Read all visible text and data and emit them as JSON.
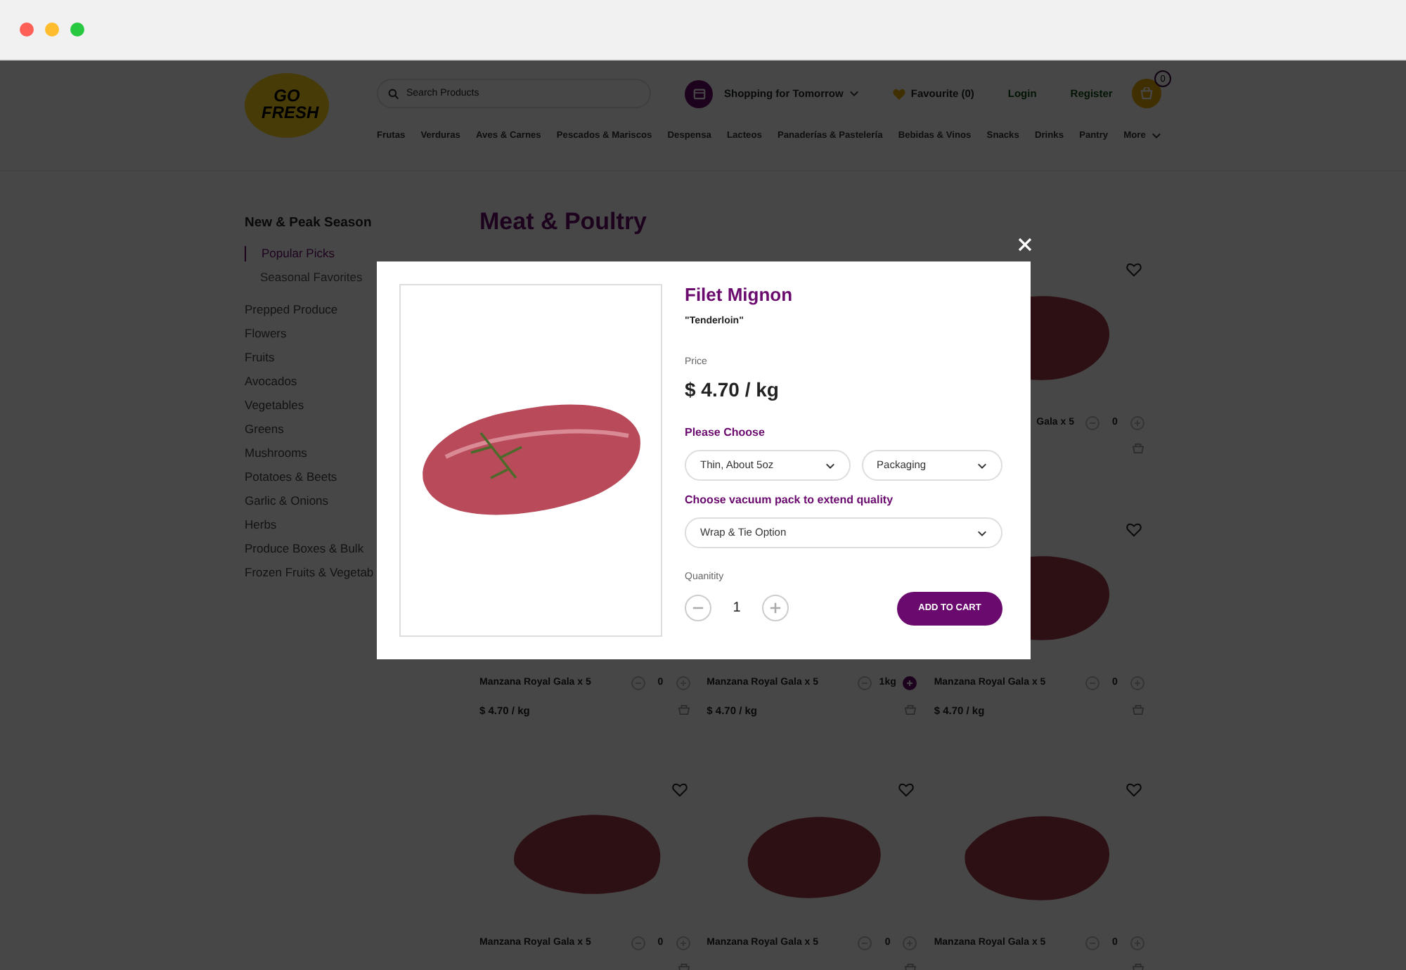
{
  "window": {
    "controls": [
      {
        "color": "#fe5f57"
      },
      {
        "color": "#febc2e"
      },
      {
        "color": "#28c840"
      }
    ]
  },
  "header": {
    "logo": "GO FRESH",
    "search": {
      "placeholder": "Search Products"
    },
    "delivery": "Shopping for Tomorrow",
    "favourite": "Favourite (0)",
    "login": "Login",
    "register": "Register",
    "cart_count": "0",
    "nav": [
      "Frutas",
      "Verduras",
      "Aves & Carnes",
      "Pescados & Mariscos",
      "Despensa",
      "Lacteos",
      "Panaderías & Pastelería",
      "Bebidas & Vinos",
      "Snacks",
      "Drinks",
      "Pantry"
    ],
    "more": "More"
  },
  "sidebar": {
    "heading": "New & Peak Season",
    "subitems": [
      {
        "label": "Popular Picks",
        "selected": true
      },
      {
        "label": "Seasonal Favorites",
        "selected": false
      }
    ],
    "items": [
      "Prepped Produce",
      "Flowers",
      "Fruits",
      "Avocados",
      "Vegetables",
      "Greens",
      "Mushrooms",
      "Potatoes & Beets",
      "Garlic & Onions",
      "Herbs",
      "Produce Boxes & Bulk",
      "Frozen Fruits & Vegetab"
    ]
  },
  "page_title": "Meat & Poultry",
  "products": [
    {
      "kind": "covered"
    },
    {
      "kind": "covered"
    },
    {
      "kind": "clipped",
      "name": "Gala x 5",
      "quantity": "0",
      "in_cart": false
    },
    {
      "kind": "full",
      "name": "Manzana Royal Gala x 5",
      "quantity": "0",
      "in_cart": false,
      "price": "$ 4.70 / kg"
    },
    {
      "kind": "full",
      "name": "Manzana Royal Gala x 5",
      "quantity": "1kg",
      "in_cart": true,
      "price": "$ 4.70 / kg"
    },
    {
      "kind": "full",
      "name": "Manzana Royal Gala x 5",
      "quantity": "0",
      "in_cart": false,
      "price": "$ 4.70 / kg"
    },
    {
      "kind": "full",
      "name": "Manzana Royal Gala x 5",
      "quantity": "0",
      "in_cart": false
    },
    {
      "kind": "full",
      "name": "Manzana Royal Gala x 5",
      "quantity": "0",
      "in_cart": false
    },
    {
      "kind": "full",
      "name": "Manzana Royal Gala x 5",
      "quantity": "0",
      "in_cart": false
    }
  ],
  "modal": {
    "title": "Filet Mignon",
    "subtitle": "\"Tenderloin\"",
    "price_label": "Price",
    "price": "$ 4.70 / kg",
    "choose_label": "Please Choose",
    "options": [
      {
        "value": "Thin, About 5oz"
      },
      {
        "value": "Packaging"
      }
    ],
    "vacuum_label": "Choose vacuum pack to extend quality",
    "vacuum_option": "Wrap & Tie Option",
    "quantity_label": "Quanitity",
    "quantity": "1",
    "add_button": "ADD TO CART"
  }
}
